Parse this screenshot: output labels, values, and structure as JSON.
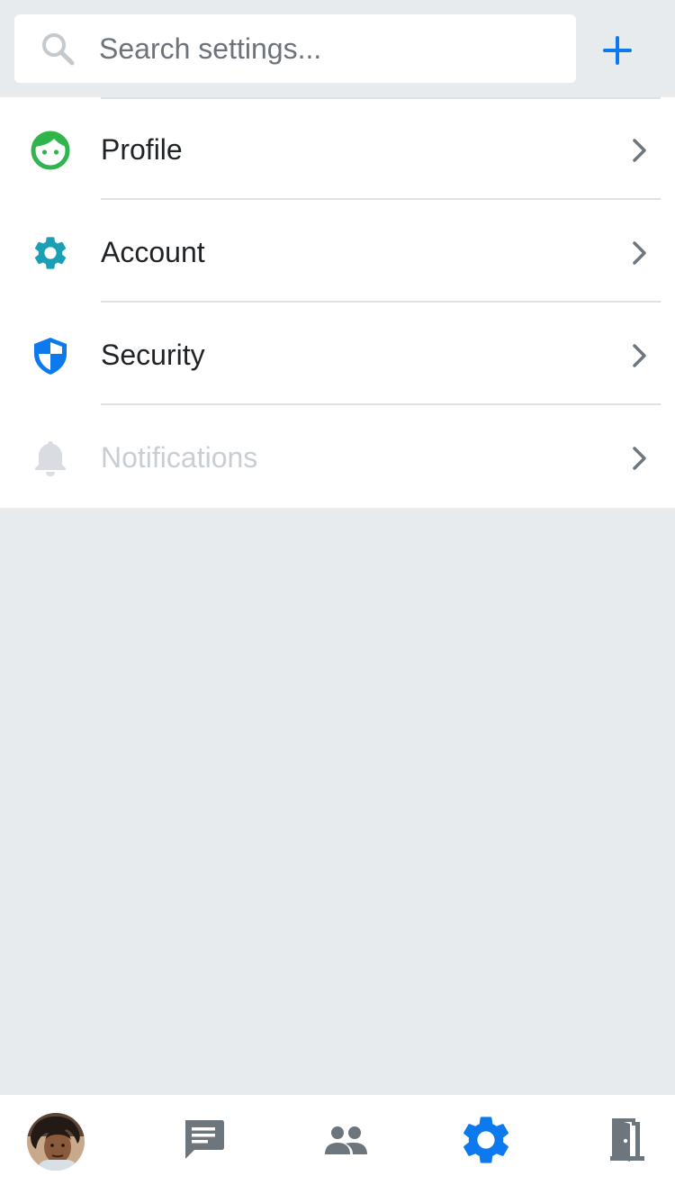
{
  "search": {
    "placeholder": "Search settings..."
  },
  "settings": {
    "items": [
      {
        "label": "Profile",
        "icon": "face-icon",
        "color": "#2fb54b",
        "disabled": false
      },
      {
        "label": "Account",
        "icon": "gear-icon",
        "color": "#1b9fb5",
        "disabled": false
      },
      {
        "label": "Security",
        "icon": "shield-icon",
        "color": "#0d79ef",
        "disabled": false
      },
      {
        "label": "Notifications",
        "icon": "bell-icon",
        "color": "#d9dde1",
        "disabled": true
      }
    ]
  },
  "nav": {
    "items": [
      {
        "icon": "avatar",
        "active": false
      },
      {
        "icon": "chat-icon",
        "active": false
      },
      {
        "icon": "people-icon",
        "active": false
      },
      {
        "icon": "gear-icon",
        "active": true
      },
      {
        "icon": "door-exit-icon",
        "active": false
      }
    ],
    "active_color": "#0d79ef",
    "inactive_color": "#6d757d"
  },
  "colors": {
    "accent": "#0d79ef",
    "background": "#e8ebee"
  }
}
